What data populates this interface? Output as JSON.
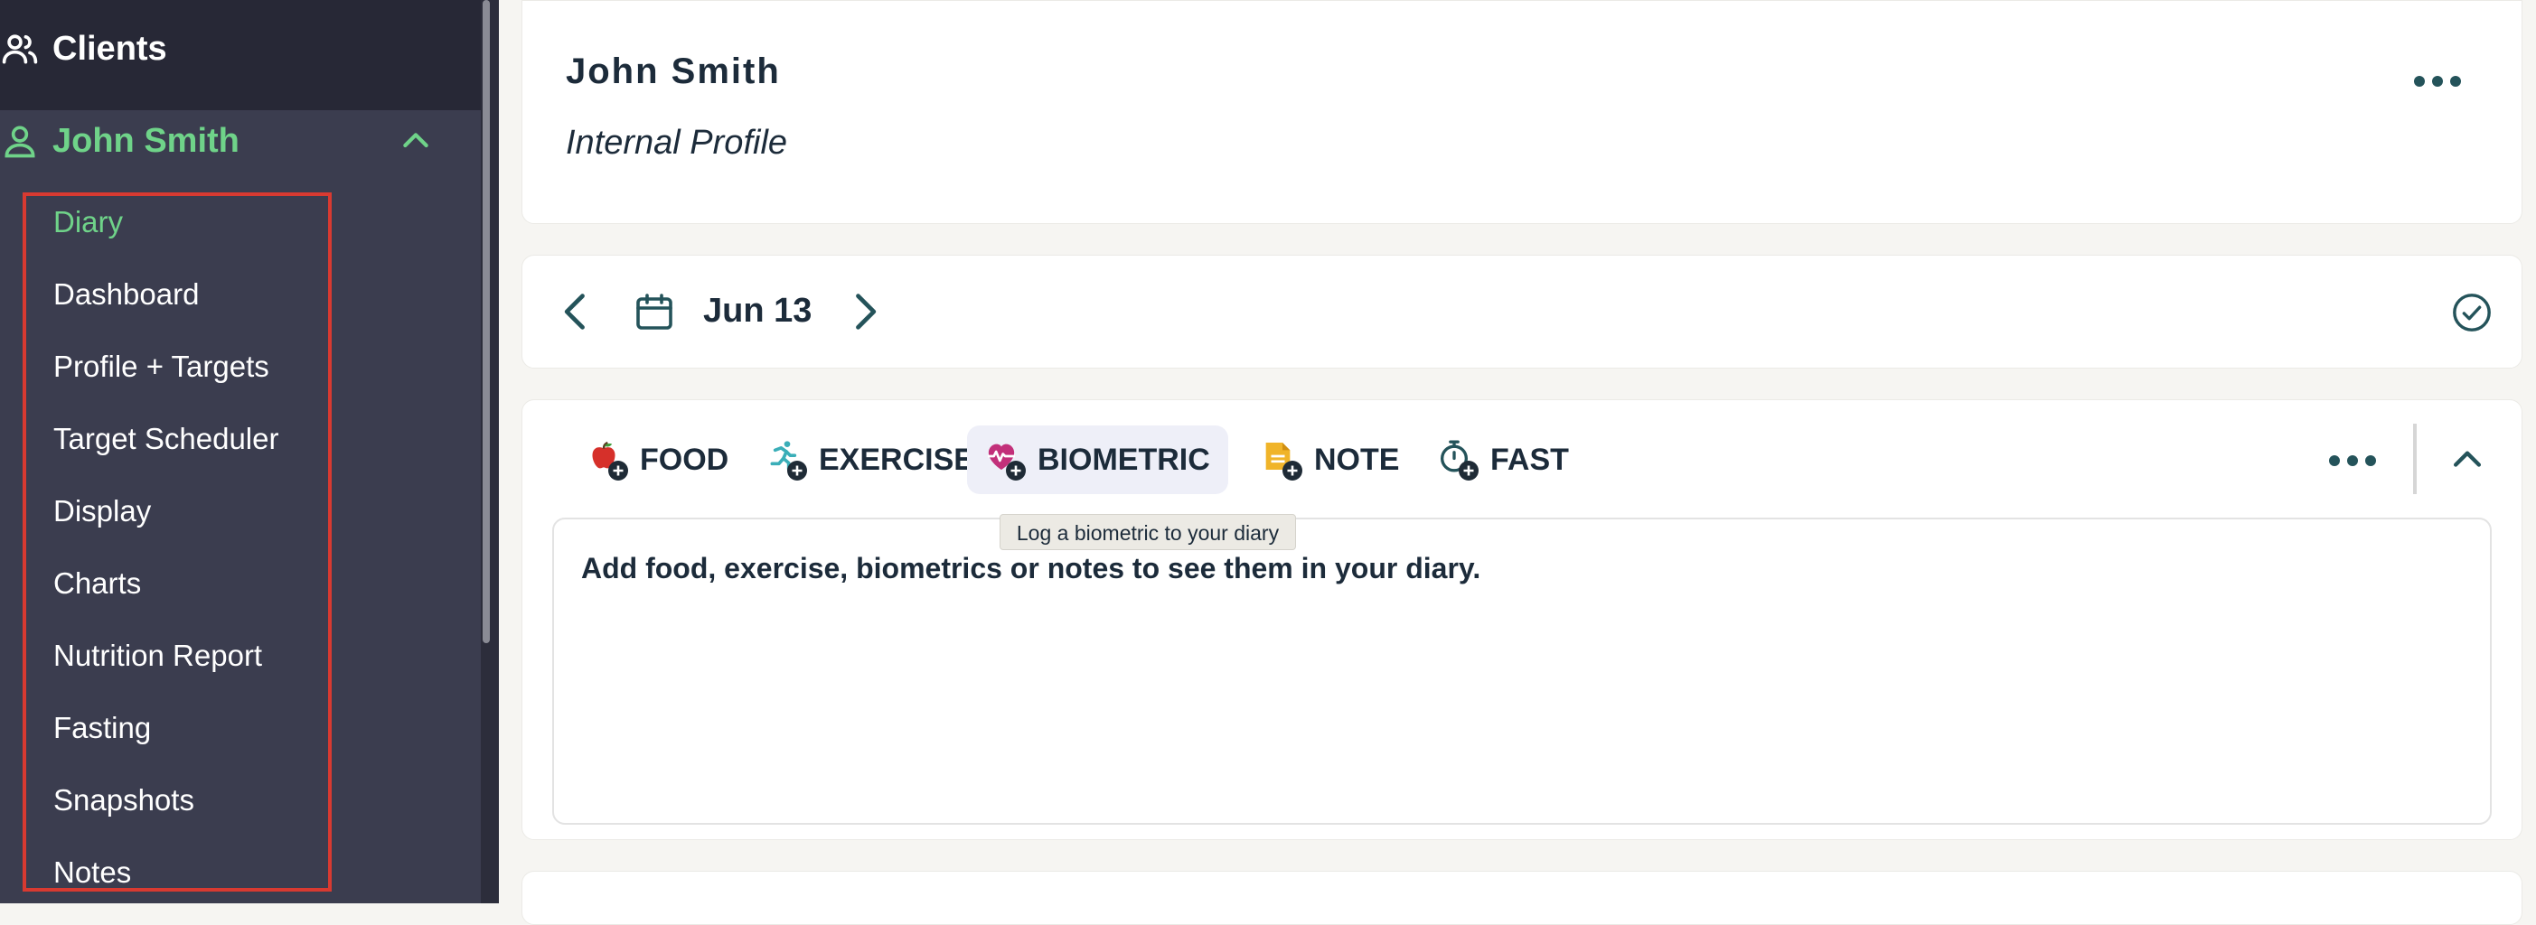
{
  "sidebar": {
    "clients_label": "Clients",
    "client_name": "John Smith",
    "nav": [
      {
        "label": "Diary",
        "active": true
      },
      {
        "label": "Dashboard"
      },
      {
        "label": "Profile + Targets"
      },
      {
        "label": "Target Scheduler"
      },
      {
        "label": "Display"
      },
      {
        "label": "Charts"
      },
      {
        "label": "Nutrition Report"
      },
      {
        "label": "Fasting"
      },
      {
        "label": "Snapshots"
      },
      {
        "label": "Notes"
      }
    ]
  },
  "profile": {
    "name": "John Smith",
    "subtitle": "Internal Profile"
  },
  "date_nav": {
    "date": "Jun 13"
  },
  "diary": {
    "tabs": [
      {
        "label": "FOOD",
        "icon": "apple-plus-icon"
      },
      {
        "label": "EXERCISE",
        "icon": "runner-plus-icon"
      },
      {
        "label": "BIOMETRIC",
        "icon": "heart-pulse-plus-icon",
        "active": true
      },
      {
        "label": "NOTE",
        "icon": "note-plus-icon"
      },
      {
        "label": "FAST",
        "icon": "stopwatch-plus-icon"
      }
    ],
    "tooltip": "Log a biometric to your diary",
    "empty_message": "Add food, exercise, biometrics or notes to see them in your diary."
  },
  "colors": {
    "sidebar_bg": "#3b3d4f",
    "sidebar_top_bg": "#272836",
    "accent_green": "#6fd389",
    "highlight_red": "#d83a31",
    "teal_icon": "#24535a",
    "text_dark": "#1c2b3a"
  }
}
